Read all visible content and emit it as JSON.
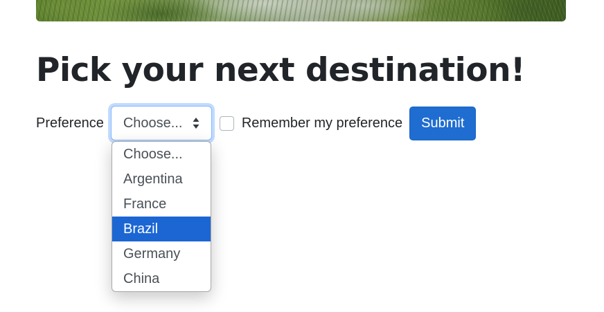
{
  "page": {
    "heading": "Pick your next destination!"
  },
  "form": {
    "preference_label": "Preference",
    "select_value": "Choose...",
    "remember_label": "Remember my preference",
    "remember_checked": false,
    "submit_label": "Submit"
  },
  "dropdown": {
    "options": [
      "Choose...",
      "Argentina",
      "France",
      "Brazil",
      "Germany",
      "China"
    ],
    "highlighted": "Brazil"
  },
  "colors": {
    "primary": "#1f6dd0",
    "highlight": "#1c66d4",
    "focus_border": "#86b7fe",
    "text": "#212529"
  },
  "icons": {
    "select_caret": "updown-chevron-icon",
    "hero": "jungle-landscape-image"
  }
}
